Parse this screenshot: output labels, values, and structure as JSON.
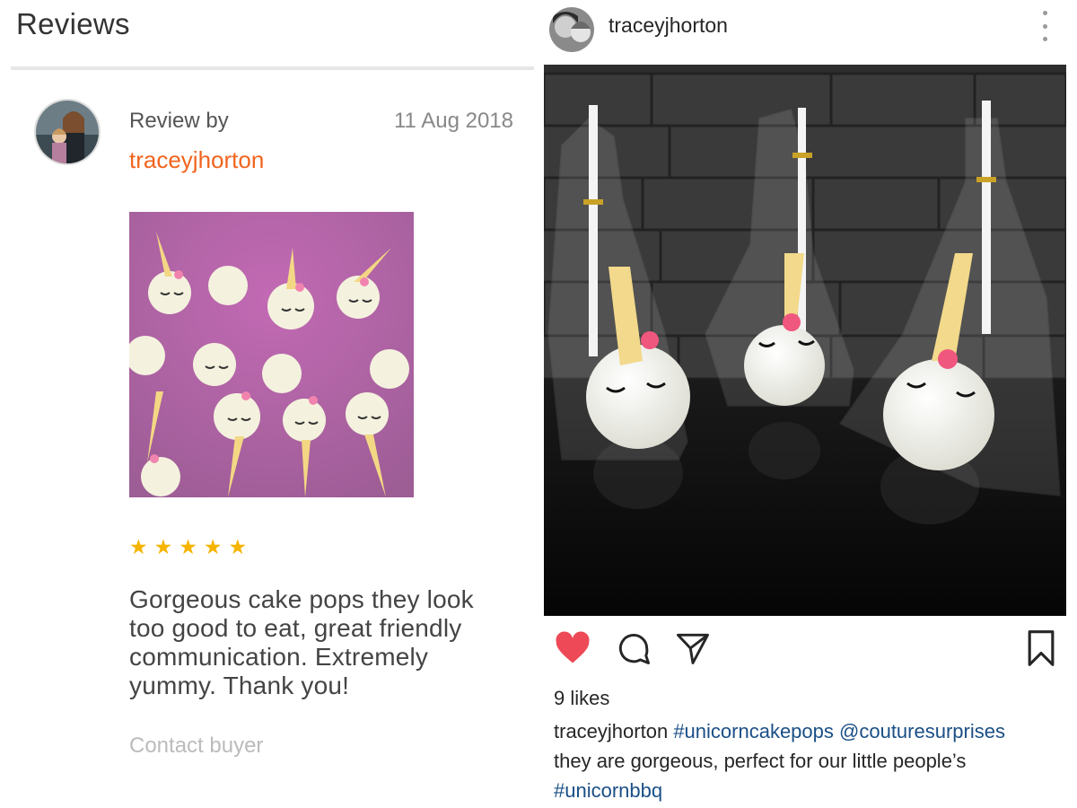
{
  "review": {
    "section_title": "Reviews",
    "review_by_label": "Review by",
    "username": "traceyjhorton",
    "date": "11 Aug 2018",
    "rating": 5,
    "rating_stars": "★ ★ ★ ★ ★",
    "text": "Gorgeous cake pops they look too good to eat, great friendly communication. Extremely yummy. Thank you!",
    "contact_label": "Contact buyer"
  },
  "instagram": {
    "username": "traceyjhorton",
    "likes": "9 likes",
    "caption": {
      "user": "traceyjhorton",
      "hashtag1": "#unicorncakepops",
      "mention": "@couturesurprises",
      "body": "they are gorgeous, perfect for our little people’s",
      "hashtag2": "#unicornbbq"
    },
    "liked": true
  },
  "icons": {
    "star": "star-icon",
    "more": "more-vertical-icon",
    "heart": "heart-icon",
    "comment": "comment-icon",
    "share": "share-icon",
    "save": "bookmark-icon"
  },
  "colors": {
    "etsy_orange": "#f1641e",
    "star_gold": "#f5b400",
    "ig_heart": "#ed4956",
    "ig_link": "#1a4f86"
  }
}
